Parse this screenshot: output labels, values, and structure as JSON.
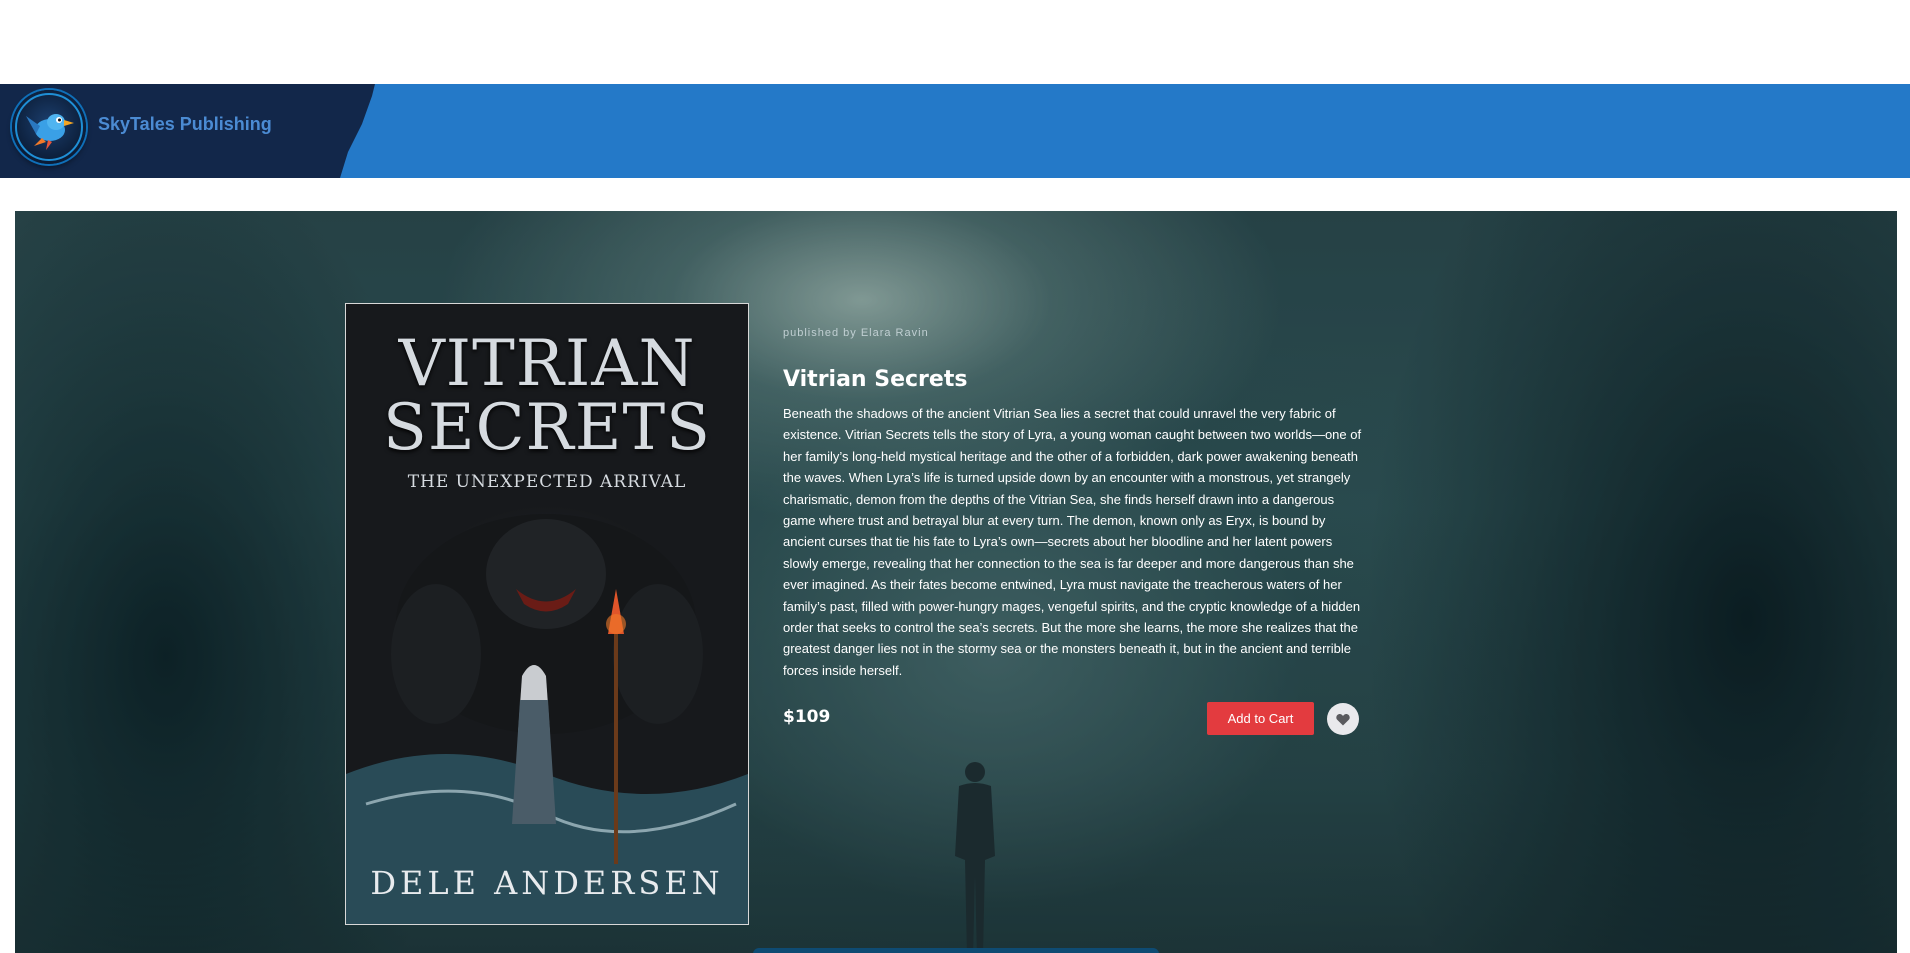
{
  "brand": {
    "name": "SkyTales Publishing",
    "logo_icon": "bird-logo-icon"
  },
  "book": {
    "published_by": "published by Elara Ravin",
    "title": "Vitrian Secrets",
    "description": "Beneath the shadows of the ancient Vitrian Sea lies a secret that could unravel the very fabric of existence. Vitrian Secrets tells the story of Lyra, a young woman caught between two worlds—one of her family’s long-held mystical heritage and the other of a forbidden, dark power awakening beneath the waves. When Lyra’s life is turned upside down by an encounter with a monstrous, yet strangely charismatic, demon from the depths of the Vitrian Sea, she finds herself drawn into a dangerous game where trust and betrayal blur at every turn. The demon, known only as Eryx, is bound by ancient curses that tie his fate to Lyra’s own—secrets about her bloodline and her latent powers slowly emerge, revealing that her connection to the sea is far deeper and more dangerous than she ever imagined. As their fates become entwined, Lyra must navigate the treacherous waters of her family’s past, filled with power-hungry mages, vengeful spirits, and the cryptic knowledge of a hidden order that seeks to control the sea’s secrets. But the more she learns, the more she realizes that the greatest danger lies not in the stormy sea or the monsters beneath it, but in the ancient and terrible forces inside herself.",
    "price": "$109",
    "add_to_cart_label": "Add to Cart",
    "favorite_icon": "heart-icon",
    "cover": {
      "title_line1": "VITRIAN",
      "title_line2": "SECRETS",
      "subtitle": "THE UNEXPECTED ARRIVAL",
      "author": "DELE ANDERSEN"
    }
  },
  "colors": {
    "navbar": "#2479c8",
    "brand_panel": "#12274a",
    "brand_text": "#4b8bd3",
    "cart_button": "#e33b3f"
  }
}
